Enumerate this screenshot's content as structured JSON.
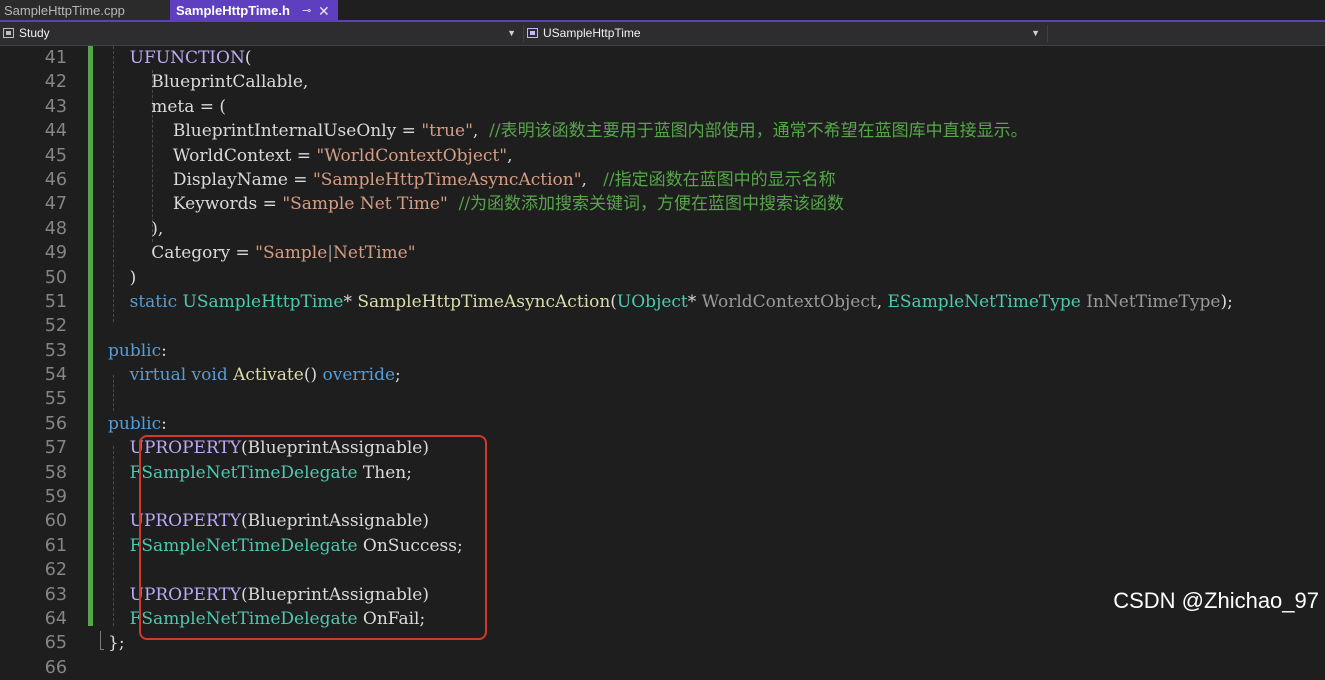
{
  "tabs": [
    {
      "label": "SampleHttpTime.cpp",
      "active": false
    },
    {
      "label": "SampleHttpTime.h",
      "active": true,
      "pin_glyph": "⊸",
      "close_glyph": "✕"
    }
  ],
  "navigation": {
    "project": "Study",
    "class": "USampleHttpTime"
  },
  "lines": [
    {
      "n": "41",
      "code": [
        [
          "mc",
          "    UFUNCTION"
        ],
        [
          "tx",
          "("
        ]
      ]
    },
    {
      "n": "42",
      "code": [
        [
          "tx",
          "        BlueprintCallable,"
        ]
      ]
    },
    {
      "n": "43",
      "code": [
        [
          "tx",
          "        meta = ("
        ]
      ]
    },
    {
      "n": "44",
      "code": [
        [
          "tx",
          "            BlueprintInternalUseOnly = "
        ],
        [
          "st",
          "\"true\""
        ],
        [
          "tx",
          ",  "
        ],
        [
          "cm",
          "//表明该函数主要用于蓝图内部使用，通常不希望在蓝图库中直接显示。"
        ]
      ]
    },
    {
      "n": "45",
      "code": [
        [
          "tx",
          "            WorldContext = "
        ],
        [
          "st",
          "\"WorldContextObject\""
        ],
        [
          "tx",
          ","
        ]
      ]
    },
    {
      "n": "46",
      "code": [
        [
          "tx",
          "            DisplayName = "
        ],
        [
          "st",
          "\"SampleHttpTimeAsyncAction\""
        ],
        [
          "tx",
          ",   "
        ],
        [
          "cm",
          "//指定函数在蓝图中的显示名称"
        ]
      ]
    },
    {
      "n": "47",
      "code": [
        [
          "tx",
          "            Keywords = "
        ],
        [
          "st",
          "\"Sample Net Time\""
        ],
        [
          "tx",
          "  "
        ],
        [
          "cm",
          "//为函数添加搜索关键词，方便在蓝图中搜索该函数"
        ]
      ]
    },
    {
      "n": "48",
      "code": [
        [
          "tx",
          "        ),"
        ]
      ]
    },
    {
      "n": "49",
      "code": [
        [
          "tx",
          "        Category = "
        ],
        [
          "st",
          "\"Sample"
        ],
        [
          "pm",
          "|"
        ],
        [
          "st",
          "NetTime\""
        ]
      ]
    },
    {
      "n": "50",
      "code": [
        [
          "tx",
          "    )"
        ]
      ]
    },
    {
      "n": "51",
      "code": [
        [
          "kw",
          "    static "
        ],
        [
          "ty",
          "USampleHttpTime"
        ],
        [
          "tx",
          "* "
        ],
        [
          "fn",
          "SampleHttpTimeAsyncAction"
        ],
        [
          "tx",
          "("
        ],
        [
          "ty",
          "UObject"
        ],
        [
          "tx",
          "* "
        ],
        [
          "pm",
          "WorldContextObject"
        ],
        [
          "tx",
          ", "
        ],
        [
          "ty",
          "ESampleNetTimeType"
        ],
        [
          "tx",
          " "
        ],
        [
          "pm",
          "InNetTimeType"
        ],
        [
          "tx",
          ");"
        ]
      ]
    },
    {
      "n": "52",
      "code": []
    },
    {
      "n": "53",
      "code": [
        [
          "kw",
          "public"
        ],
        [
          "tx",
          ":"
        ]
      ]
    },
    {
      "n": "54",
      "code": [
        [
          "kw",
          "    virtual void "
        ],
        [
          "fn",
          "Activate"
        ],
        [
          "tx",
          "() "
        ],
        [
          "kw",
          "override"
        ],
        [
          "tx",
          ";"
        ]
      ]
    },
    {
      "n": "55",
      "code": []
    },
    {
      "n": "56",
      "code": [
        [
          "kw",
          "public"
        ],
        [
          "tx",
          ":"
        ]
      ]
    },
    {
      "n": "57",
      "code": [
        [
          "mc",
          "    UPROPERTY"
        ],
        [
          "tx",
          "(BlueprintAssignable)"
        ]
      ]
    },
    {
      "n": "58",
      "code": [
        [
          "ty",
          "    FSampleNetTimeDelegate"
        ],
        [
          "tx",
          " Then;"
        ]
      ]
    },
    {
      "n": "59",
      "code": []
    },
    {
      "n": "60",
      "code": [
        [
          "mc",
          "    UPROPERTY"
        ],
        [
          "tx",
          "(BlueprintAssignable)"
        ]
      ]
    },
    {
      "n": "61",
      "code": [
        [
          "ty",
          "    FSampleNetTimeDelegate"
        ],
        [
          "tx",
          " OnSuccess;"
        ]
      ]
    },
    {
      "n": "62",
      "code": []
    },
    {
      "n": "63",
      "code": [
        [
          "mc",
          "    UPROPERTY"
        ],
        [
          "tx",
          "(BlueprintAssignable)"
        ]
      ]
    },
    {
      "n": "64",
      "code": [
        [
          "ty",
          "    FSampleNetTimeDelegate"
        ],
        [
          "tx",
          " OnFail;"
        ]
      ]
    },
    {
      "n": "65",
      "code": [
        [
          "tx",
          "};"
        ]
      ]
    },
    {
      "n": "66",
      "code": []
    }
  ],
  "watermark": "CSDN @Zhichao_97"
}
